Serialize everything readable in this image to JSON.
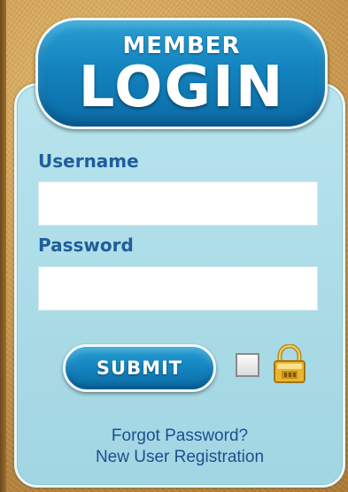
{
  "header": {
    "line1": "MEMBER",
    "line2": "LOGIN"
  },
  "username": {
    "label": "Username",
    "value": ""
  },
  "password": {
    "label": "Password",
    "value": ""
  },
  "actions": {
    "submit_label": "SUBMIT",
    "remember_checked": false,
    "lock_icon": "padlock-icon"
  },
  "links": {
    "forgot_password": "Forgot Password?",
    "new_registration": "New User Registration"
  },
  "colors": {
    "accent_blue": "#1384bf",
    "panel_bg": "#a9dbe6",
    "label_text": "#1f5e9c",
    "link_text": "#1c4f8e",
    "page_bg": "#c89a52"
  }
}
